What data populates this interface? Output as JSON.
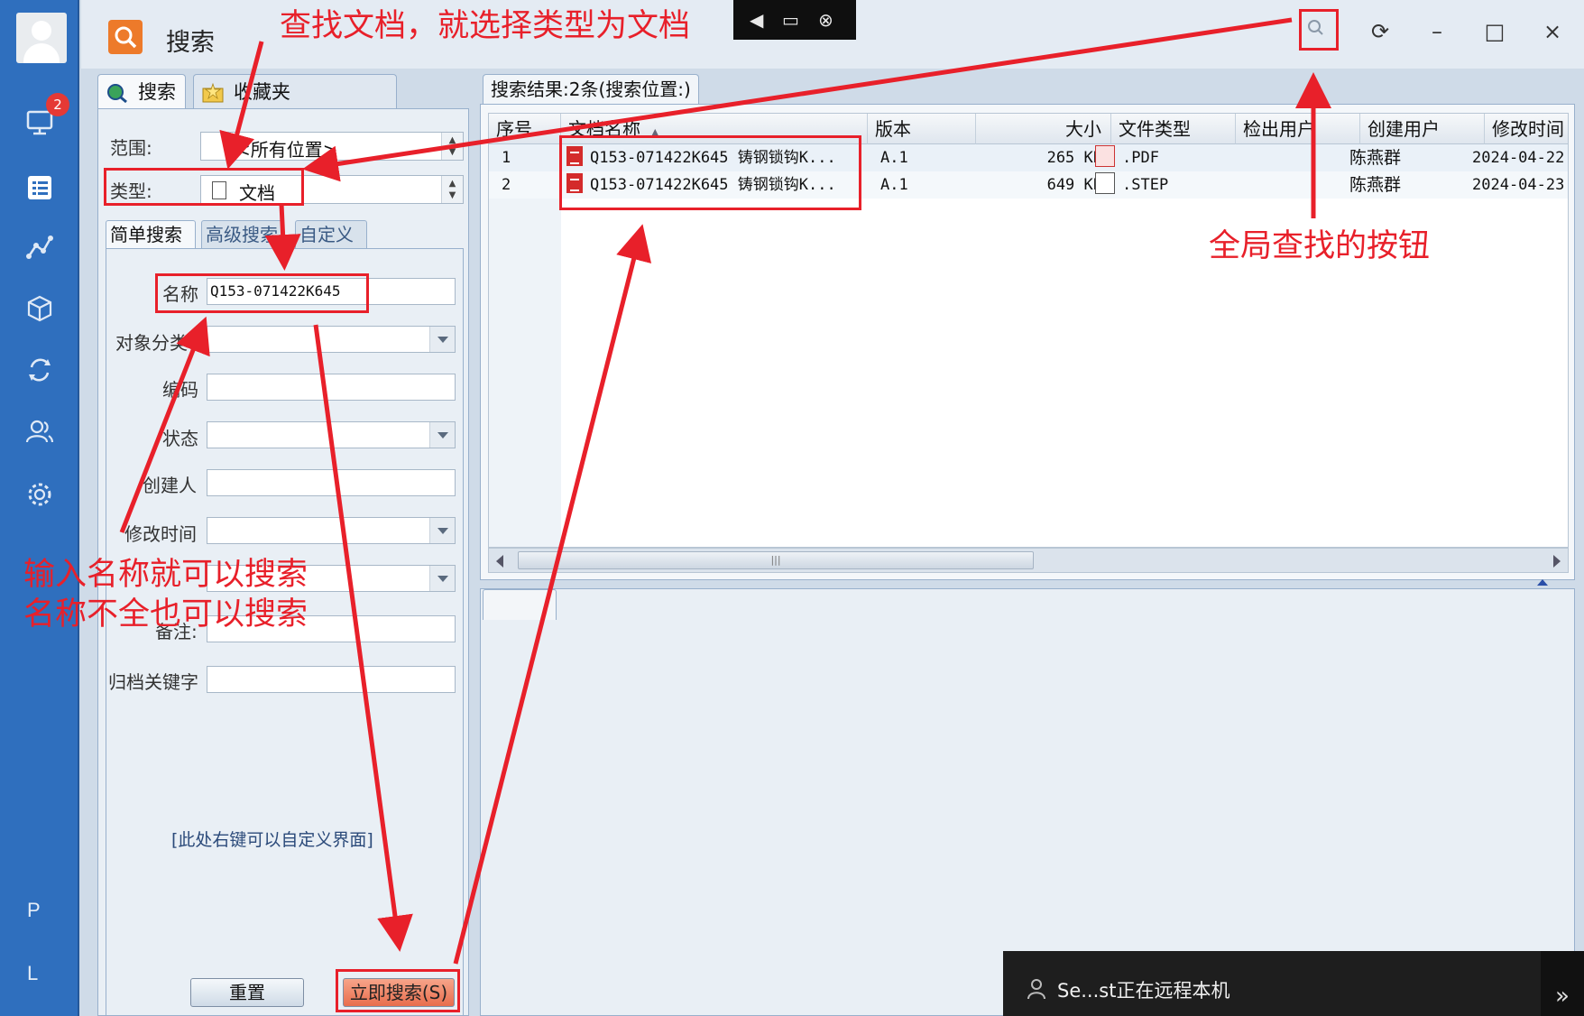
{
  "app": {
    "title": "搜索"
  },
  "rail": {
    "badge_count": "2",
    "letters": [
      "P",
      "L"
    ]
  },
  "left_tabs": [
    {
      "label": "搜索"
    },
    {
      "label": "收藏夹"
    }
  ],
  "scope": {
    "label": "范围:",
    "value": "<所有位置>"
  },
  "type": {
    "label": "类型:",
    "value": "文档"
  },
  "search_subtabs": [
    {
      "label": "简单搜索"
    },
    {
      "label": "高级搜索"
    },
    {
      "label": "自定义"
    }
  ],
  "fields": {
    "name": {
      "label": "名称",
      "value": "Q153-071422K645"
    },
    "category": {
      "label": "对象分类"
    },
    "code": {
      "label": "编码"
    },
    "status": {
      "label": "状态"
    },
    "creator": {
      "label": "创建人"
    },
    "modified": {
      "label": "修改时间"
    },
    "remark": {
      "label": "备注:"
    },
    "archive_keyword": {
      "label": "归档关键字"
    }
  },
  "custom_hint": "[此处右键可以自定义界面]",
  "buttons": {
    "reset": "重置",
    "search_now": "立即搜索(S)"
  },
  "results": {
    "tab_label": "搜索结果:2条(搜索位置:)",
    "columns": [
      "序号",
      "文档名称",
      "版本",
      "大小",
      "文件类型",
      "检出用户",
      "创建用户",
      "修改时间"
    ],
    "rows": [
      {
        "seq": "1",
        "name": "Q153-071422K645 铸钢锁钩K...",
        "version": "A.1",
        "size": "265 KB",
        "type": ".PDF",
        "checkout_user": "",
        "creator": "陈燕群",
        "modified": "2024-04-22"
      },
      {
        "seq": "2",
        "name": "Q153-071422K645 铸钢锁钩K...",
        "version": "A.1",
        "size": "649 KB",
        "type": ".STEP",
        "checkout_user": "",
        "creator": "陈燕群",
        "modified": "2024-04-23"
      }
    ]
  },
  "notification": "Se...st正在远程本机",
  "annotations": {
    "top": "查找文档，就选择类型为文档",
    "right": "全局查找的按钮",
    "left_line1": "输入名称就可以搜索",
    "left_line2": "名称不全也可以搜索"
  },
  "colors": {
    "annotation": "#e8202a",
    "rail": "#2f6fbe",
    "accent_button": "#e86d4d"
  }
}
